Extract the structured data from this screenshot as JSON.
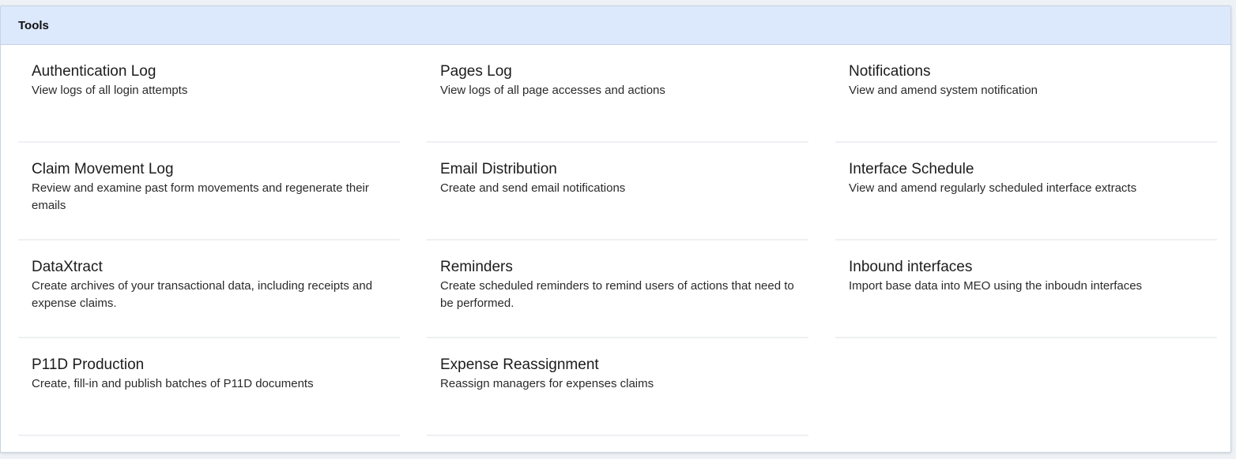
{
  "panel": {
    "title": "Tools"
  },
  "tools": [
    {
      "title": "Authentication Log",
      "description": "View logs of all login attempts"
    },
    {
      "title": "Pages Log",
      "description": "View logs of all page accesses and actions"
    },
    {
      "title": "Notifications",
      "description": "View and amend system notification"
    },
    {
      "title": "Claim Movement Log",
      "description": "Review and examine past form movements and regenerate their emails"
    },
    {
      "title": "Email Distribution",
      "description": "Create and send email notifications"
    },
    {
      "title": "Interface Schedule",
      "description": "View and amend regularly scheduled interface extracts"
    },
    {
      "title": "DataXtract",
      "description": "Create archives of your transactional data, including receipts and expense claims."
    },
    {
      "title": "Reminders",
      "description": "Create scheduled reminders to remind users of actions that need to be performed."
    },
    {
      "title": "Inbound interfaces",
      "description": "Import base data into MEO using the inboudn interfaces"
    },
    {
      "title": "P11D Production",
      "description": "Create, fill-in and publish batches of P11D documents"
    },
    {
      "title": "Expense Reassignment",
      "description": "Reassign managers for expenses claims"
    }
  ]
}
